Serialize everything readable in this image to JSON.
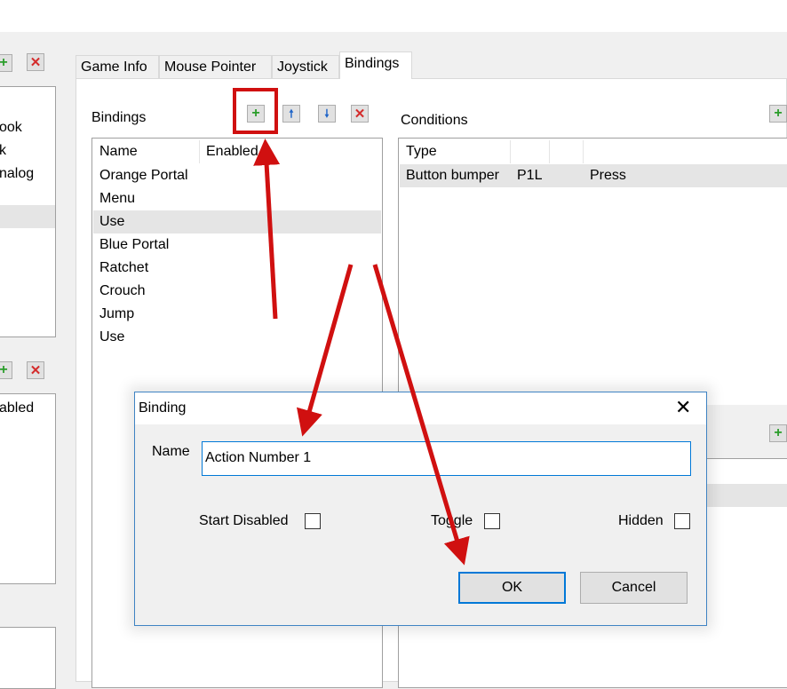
{
  "tabs": [
    "Game Info",
    "Mouse Pointer",
    "Joystick",
    "Bindings"
  ],
  "left_list_partial": [
    "ook",
    "k",
    "nalog"
  ],
  "left_list2_partial": "abled",
  "bindings": {
    "label": "Bindings",
    "columns": [
      "Name",
      "Enabled"
    ],
    "rows": [
      "Orange Portal",
      "Menu",
      "Use",
      "Blue Portal",
      "Ratchet",
      "Crouch",
      "Jump",
      "Use"
    ]
  },
  "conditions": {
    "label": "Conditions",
    "columns": [
      "Type"
    ],
    "rows": [
      {
        "type": "Button bumper",
        "key": "P1L",
        "action": "Press"
      }
    ]
  },
  "dialog": {
    "title": "Binding",
    "name_label": "Name",
    "name_value": "Action Number 1",
    "start_disabled_label": "Start Disabled",
    "toggle_label": "Toggle",
    "hidden_label": "Hidden",
    "ok_label": "OK",
    "cancel_label": "Cancel"
  },
  "annotation_color": "#d01010"
}
